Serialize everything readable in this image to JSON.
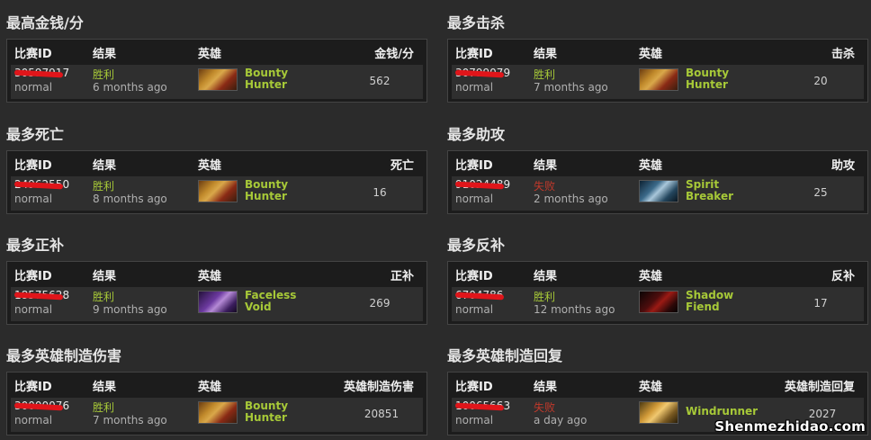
{
  "sections": [
    {
      "title": "最高金钱/分",
      "headers": {
        "id": "比赛ID",
        "result": "结果",
        "hero": "英雄",
        "value": "金钱/分"
      },
      "row": {
        "match_id": "30597917",
        "mode": "normal",
        "result": "胜利",
        "result_type": "win",
        "when": "6 months ago",
        "hero_line1": "Bounty",
        "hero_line2": "Hunter",
        "hero_icon": "bounty",
        "value": "562"
      }
    },
    {
      "title": "最多击杀",
      "headers": {
        "id": "比赛ID",
        "result": "结果",
        "hero": "英雄",
        "value": "击杀"
      },
      "row": {
        "match_id": "30799079",
        "mode": "normal",
        "result": "胜利",
        "result_type": "win",
        "when": "7 months ago",
        "hero_line1": "Bounty",
        "hero_line2": "Hunter",
        "hero_icon": "bounty",
        "value": "20"
      }
    },
    {
      "title": "最多死亡",
      "headers": {
        "id": "比赛ID",
        "result": "结果",
        "hero": "英雄",
        "value": "死亡"
      },
      "row": {
        "match_id": "24962550",
        "mode": "normal",
        "result": "胜利",
        "result_type": "win",
        "when": "8 months ago",
        "hero_line1": "Bounty",
        "hero_line2": "Hunter",
        "hero_icon": "bounty",
        "value": "16"
      }
    },
    {
      "title": "最多助攻",
      "headers": {
        "id": "比赛ID",
        "result": "结果",
        "hero": "英雄",
        "value": "助攻"
      },
      "row": {
        "match_id": "91024489",
        "mode": "normal",
        "result": "失败",
        "result_type": "lose",
        "when": "2 months ago",
        "hero_line1": "Spirit",
        "hero_line2": "Breaker",
        "hero_icon": "spirit",
        "value": "25"
      }
    },
    {
      "title": "最多正补",
      "headers": {
        "id": "比赛ID",
        "result": "结果",
        "hero": "英雄",
        "value": "正补"
      },
      "row": {
        "match_id": "18575628",
        "mode": "normal",
        "result": "胜利",
        "result_type": "win",
        "when": "9 months ago",
        "hero_line1": "Faceless",
        "hero_line2": "Void",
        "hero_icon": "faceless",
        "value": "269"
      }
    },
    {
      "title": "最多反补",
      "headers": {
        "id": "比赛ID",
        "result": "结果",
        "hero": "英雄",
        "value": "反补"
      },
      "row": {
        "match_id": "6704786",
        "mode": "normal",
        "result": "胜利",
        "result_type": "win",
        "when": "12 months ago",
        "hero_line1": "Shadow",
        "hero_line2": "Fiend",
        "hero_icon": "shadow",
        "value": "17"
      }
    },
    {
      "title": "最多英雄制造伤害",
      "headers": {
        "id": "比赛ID",
        "result": "结果",
        "hero": "英雄",
        "value": "英雄制造伤害"
      },
      "row": {
        "match_id": "30000076",
        "mode": "normal",
        "result": "胜利",
        "result_type": "win",
        "when": "7 months ago",
        "hero_line1": "Bounty",
        "hero_line2": "Hunter",
        "hero_icon": "bounty",
        "value": "20851"
      }
    },
    {
      "title": "最多英雄制造回复",
      "headers": {
        "id": "比赛ID",
        "result": "结果",
        "hero": "英雄",
        "value": "英雄制造回复"
      },
      "row": {
        "match_id": "10065663",
        "mode": "normal",
        "result": "失败",
        "result_type": "lose",
        "when": "a day ago",
        "hero_line1": "Windrunner",
        "hero_line2": "",
        "hero_icon": "wind",
        "value": "2027"
      }
    }
  ],
  "watermark": "Shenmezhidao.com"
}
